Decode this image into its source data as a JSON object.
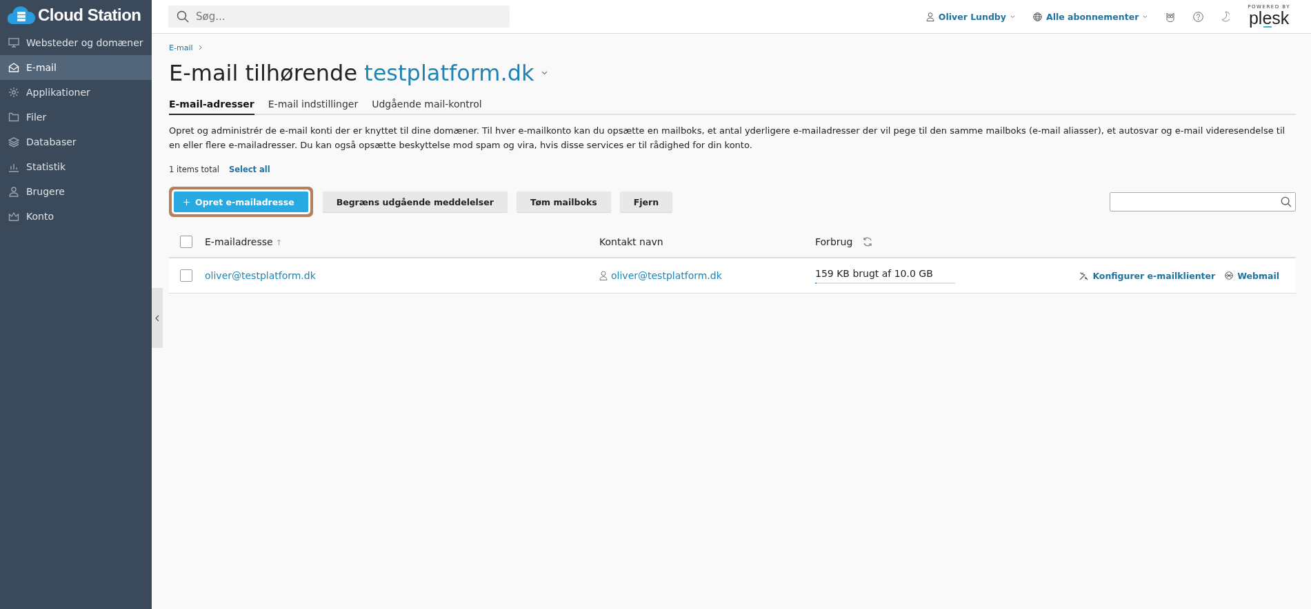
{
  "brand": {
    "name": "Cloud Station"
  },
  "sidebar": {
    "items": [
      {
        "label": "Websteder og domæner",
        "selected": false
      },
      {
        "label": "E-mail",
        "selected": true
      },
      {
        "label": "Applikationer",
        "selected": false
      },
      {
        "label": "Filer",
        "selected": false
      },
      {
        "label": "Databaser",
        "selected": false
      },
      {
        "label": "Statistik",
        "selected": false
      },
      {
        "label": "Brugere",
        "selected": false
      },
      {
        "label": "Konto",
        "selected": false
      }
    ]
  },
  "topbar": {
    "search": {
      "placeholder": "Søg..."
    },
    "user": "Oliver Lundby",
    "subscriptions": "Alle abonnementer",
    "powered_by": "POWERED BY",
    "plesk": "plesk"
  },
  "breadcrumb": [
    "E-mail"
  ],
  "title": {
    "prefix": "E-mail tilhørende",
    "domain": "testplatform.dk"
  },
  "tabs": [
    {
      "label": "E-mail-adresser",
      "selected": true
    },
    {
      "label": "E-mail indstillinger",
      "selected": false
    },
    {
      "label": "Udgående mail-kontrol",
      "selected": false
    }
  ],
  "description": "Opret og administrér de e-mail konti der er knyttet til dine domæner. Til hver e-mailkonto kan du opsætte en mailboks, et antal yderligere e-mailadresser der vil pege til den samme mailboks (e-mail aliasser), et autosvar og e-mail videresendelse til en eller flere e-mailadresser. Du kan også opsætte beskyttelse mod spam og vira, hvis disse services er til rådighed for din konto.",
  "list_info": {
    "total": "1 items total",
    "select_all": "Select all"
  },
  "toolbar": {
    "buttons": [
      {
        "label": "Opret e-mailadresse",
        "kind": "primary",
        "highlighted": true
      },
      {
        "label": "Begræns udgående meddelelser",
        "kind": "secondary",
        "highlighted": false
      },
      {
        "label": "Tøm mailboks",
        "kind": "secondary",
        "highlighted": false
      },
      {
        "label": "Fjern",
        "kind": "secondary",
        "highlighted": false
      }
    ]
  },
  "table": {
    "select_all_checked": false,
    "columns": [
      "E-mailadresse",
      "Kontakt navn",
      "Forbrug"
    ],
    "rows": [
      {
        "checked": false,
        "email": "oliver@testplatform.dk",
        "contact": "oliver@testplatform.dk",
        "usage": "159 KB brugt af 10.0 GB",
        "level": 0.01,
        "actions": [
          "Konfigurer e-mailklienter",
          "Webmail"
        ]
      }
    ]
  }
}
